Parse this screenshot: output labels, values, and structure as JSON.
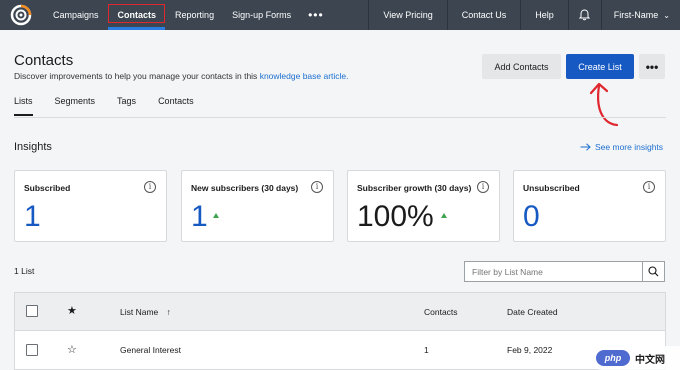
{
  "nav": {
    "left": [
      "Campaigns",
      "Contacts",
      "Reporting",
      "Sign-up Forms"
    ],
    "more": "•••",
    "right": [
      "View Pricing",
      "Contact Us",
      "Help"
    ],
    "user": "First-Name"
  },
  "header": {
    "title": "Contacts",
    "subtitle": "Discover improvements to help you manage your contacts in this",
    "link": "knowledge base article.",
    "add_contacts": "Add Contacts",
    "create_list": "Create List",
    "more": "•••"
  },
  "tabs": [
    "Lists",
    "Segments",
    "Tags",
    "Contacts"
  ],
  "insights": {
    "title": "Insights",
    "see_more": "See more insights",
    "cards": [
      {
        "label": "Subscribed",
        "value": "1"
      },
      {
        "label": "New subscribers (30 days)",
        "value": "1"
      },
      {
        "label": "Subscriber growth (30 days)",
        "value": "100%"
      },
      {
        "label": "Unsubscribed",
        "value": "0"
      }
    ]
  },
  "list": {
    "count": "1 List",
    "filter_placeholder": "Filter by List Name"
  },
  "table": {
    "headers": [
      "List Name",
      "Contacts",
      "Date Created"
    ],
    "rows": [
      {
        "name": "General Interest",
        "contacts": "1",
        "date": "Feb 9, 2022"
      }
    ]
  },
  "watermark": {
    "badge": "php",
    "text": "中文网"
  },
  "colors": {
    "nav_bg": "#3c4550",
    "primary": "#1659c3",
    "link": "#1d6fd1",
    "growth": "#3fa34d",
    "highlight": "#e0262f"
  }
}
